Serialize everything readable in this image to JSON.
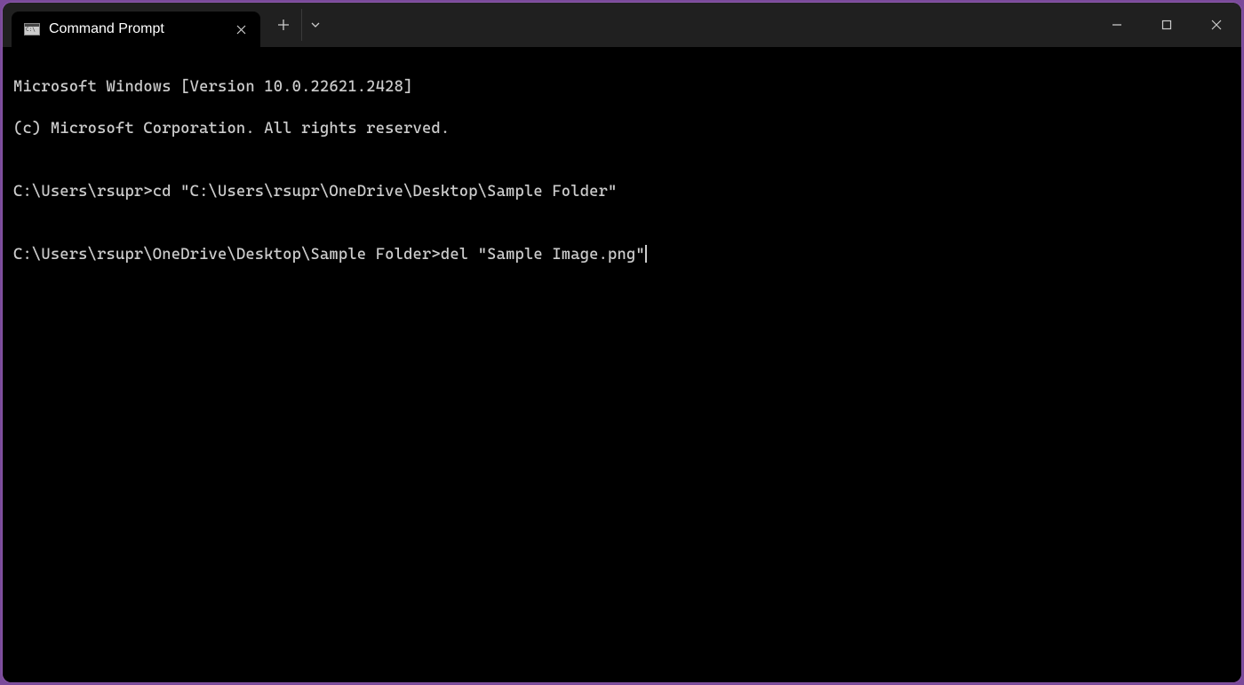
{
  "tab": {
    "title": "Command Prompt"
  },
  "terminal": {
    "banner_line1": "Microsoft Windows [Version 10.0.22621.2428]",
    "banner_line2": "(c) Microsoft Corporation. All rights reserved.",
    "blank1": "",
    "line1_prompt": "C:\\Users\\rsupr>",
    "line1_command": "cd \"C:\\Users\\rsupr\\OneDrive\\Desktop\\Sample Folder\"",
    "blank2": "",
    "line2_prompt": "C:\\Users\\rsupr\\OneDrive\\Desktop\\Sample Folder>",
    "line2_command": "del \"Sample Image.png\""
  }
}
